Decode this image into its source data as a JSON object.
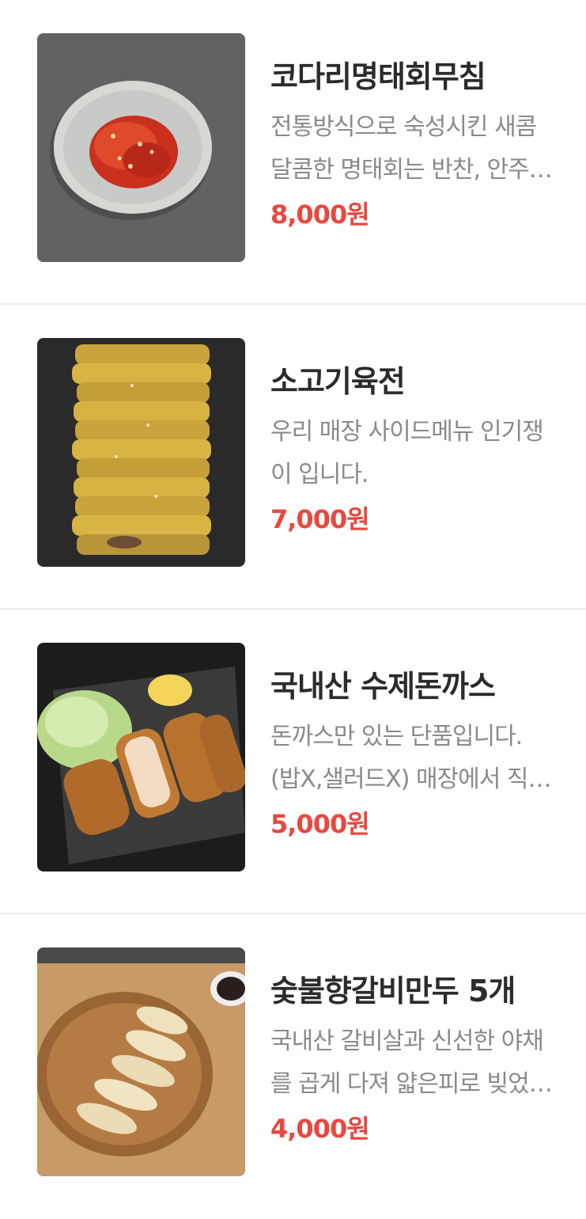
{
  "items": [
    {
      "title": "코다리명태회무침",
      "desc": "전통방식으로 숙성시킨 새콤달콤한 명태회는 반찬, 안주로 최고입니다.",
      "price": "8,000원",
      "image": "spicy-pollock-salad-photo"
    },
    {
      "title": "소고기육전",
      "desc": "우리 매장 사이드메뉴 인기쟁이 입니다.",
      "price": "7,000원",
      "image": "beef-pancake-photo"
    },
    {
      "title": "국내산 수제돈까스",
      "desc": "돈까스만 있는 단품입니다. (밥X,샐러드X) 매장에서 직접 만든 수제돈까스입니다.",
      "price": "5,000원",
      "image": "pork-cutlet-photo"
    },
    {
      "title": "숯불향갈비만두 5개",
      "desc": "국내산 갈비살과 신선한 야채를 곱게 다져 얇은피로 빚었습니다.",
      "price": "4,000원",
      "image": "galbi-dumplings-photo"
    }
  ],
  "colors": {
    "title": "#2b2b2b",
    "description": "#8a8a8a",
    "price": "#e9483f",
    "divider": "#ececec"
  }
}
